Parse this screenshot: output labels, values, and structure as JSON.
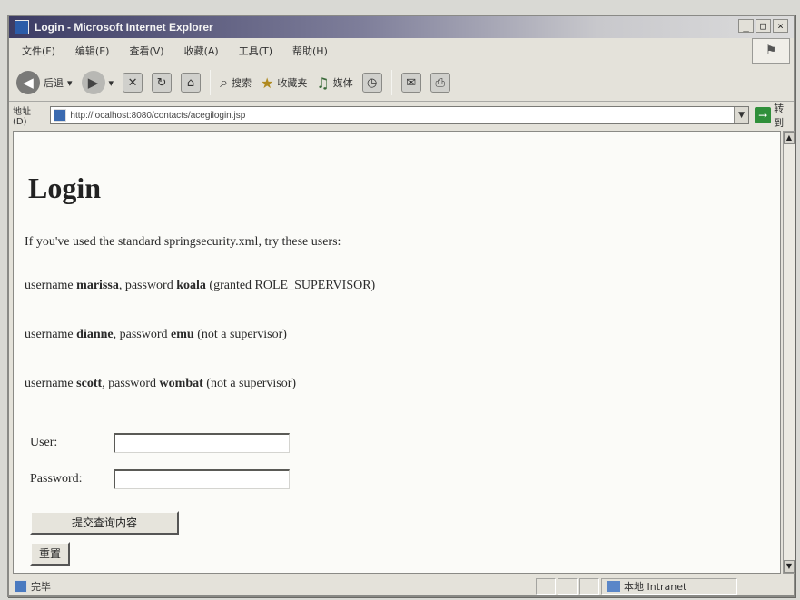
{
  "window": {
    "title": "Login - Microsoft Internet Explorer",
    "controls": {
      "minimize": "_",
      "maximize": "□",
      "close": "×"
    }
  },
  "menu": [
    "文件(F)",
    "编辑(E)",
    "查看(V)",
    "收藏(A)",
    "工具(T)",
    "帮助(H)"
  ],
  "toolbar": {
    "back_label": "后退",
    "search_label": "搜索",
    "favorites_label": "收藏夹",
    "media_label": "媒体"
  },
  "address": {
    "label": "地址(D)",
    "url": "http://localhost:8080/contacts/acegilogin.jsp",
    "go_label": "转到"
  },
  "page": {
    "title": "Login",
    "intro": "If you've used the standard springsecurity.xml, try these users:",
    "users": [
      {
        "prefix": "username ",
        "username": "marissa",
        "mid": ", password ",
        "password": "koala",
        "note": " (granted ROLE_SUPERVISOR)"
      },
      {
        "prefix": "username ",
        "username": "dianne",
        "mid": ", password ",
        "password": "emu",
        "note": " (not a supervisor)"
      },
      {
        "prefix": "username ",
        "username": "scott",
        "mid": ", password ",
        "password": "wombat",
        "note": " (not a supervisor)"
      }
    ],
    "form": {
      "user_label": "User:",
      "user_value": "",
      "password_label": "Password:",
      "password_value": "",
      "submit_label": "提交查询内容",
      "reset_label": "重置"
    }
  },
  "status": {
    "text": "完毕",
    "zone": "本地 Intranet"
  }
}
